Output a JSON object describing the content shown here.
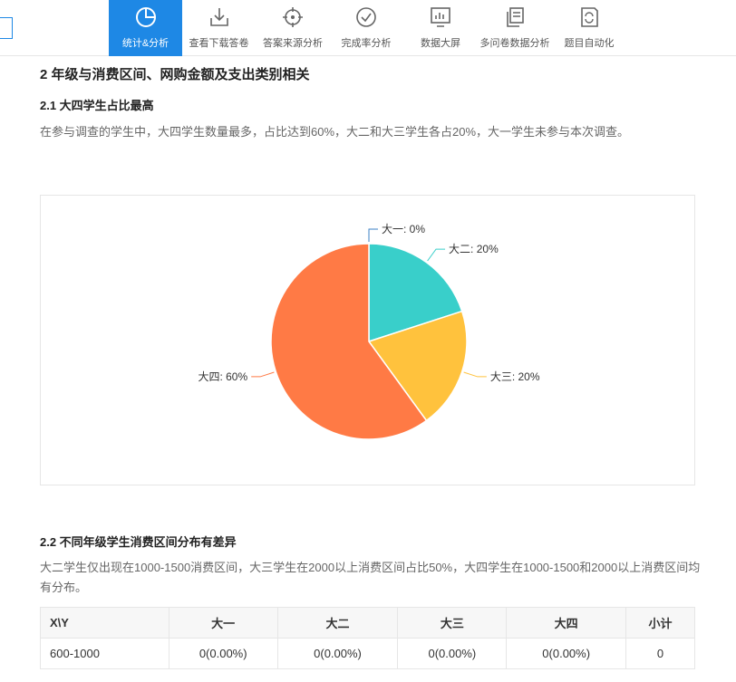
{
  "nav": {
    "items": [
      {
        "label": "统计&分析",
        "icon": "pie-chart-icon",
        "active": true
      },
      {
        "label": "查看下载答卷",
        "icon": "download-icon",
        "active": false
      },
      {
        "label": "答案来源分析",
        "icon": "crosshair-icon",
        "active": false
      },
      {
        "label": "完成率分析",
        "icon": "check-circle-icon",
        "active": false
      },
      {
        "label": "数据大屏",
        "icon": "dashboard-icon",
        "active": false
      },
      {
        "label": "多问卷数据分析",
        "icon": "copy-icon",
        "active": false
      },
      {
        "label": "题目自动化",
        "icon": "auto-icon",
        "active": false
      }
    ]
  },
  "section": {
    "title": "2 年级与消费区间、网购金额及支出类别相关",
    "sub1": {
      "title": "2.1 大四学生占比最高",
      "text": "在参与调查的学生中，大四学生数量最多，占比达到60%，大二和大三学生各占20%，大一学生未参与本次调查。"
    },
    "sub2": {
      "title": "2.2 不同年级学生消费区间分布有差异",
      "text": "大二学生仅出现在1000-1500消费区间，大三学生在2000以上消费区间占比50%，大四学生在1000-1500和2000以上消费区间均有分布。"
    }
  },
  "chart_data": {
    "type": "pie",
    "slices": [
      {
        "label": "大一: 0%",
        "name": "大一",
        "value": 0,
        "color": "#3b82c4"
      },
      {
        "label": "大二: 20%",
        "name": "大二",
        "value": 20,
        "color": "#39cfca"
      },
      {
        "label": "大三: 20%",
        "name": "大三",
        "value": 20,
        "color": "#ffc23d"
      },
      {
        "label": "大四: 60%",
        "name": "大四",
        "value": 60,
        "color": "#ff7a45"
      }
    ]
  },
  "table": {
    "headers": [
      "X\\Y",
      "大一",
      "大二",
      "大三",
      "大四",
      "小计"
    ],
    "rows": [
      [
        "600-1000",
        "0(0.00%)",
        "0(0.00%)",
        "0(0.00%)",
        "0(0.00%)",
        "0"
      ]
    ]
  }
}
